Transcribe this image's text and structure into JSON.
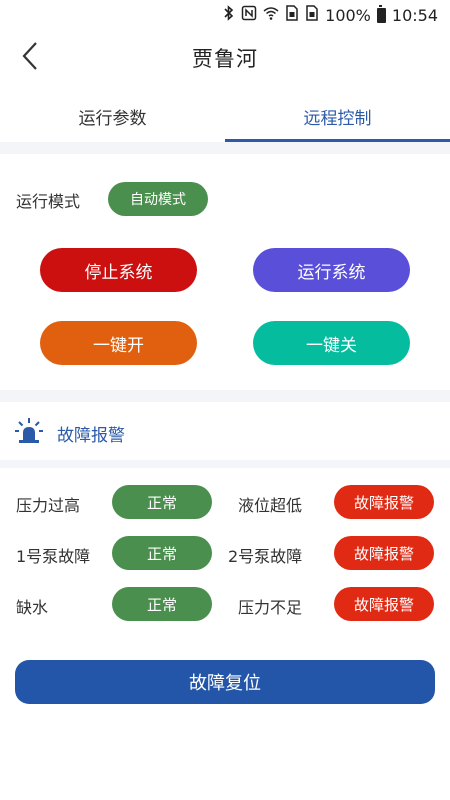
{
  "status_bar": {
    "icons": [
      "bluetooth-icon",
      "nfc-icon",
      "wifi-icon",
      "sim1-icon",
      "sim2-icon",
      "battery-icon"
    ],
    "battery": "100%",
    "time": "10:54"
  },
  "header": {
    "title": "贾鲁河",
    "back_icon": "chevron-left-icon"
  },
  "tabs": [
    {
      "label": "运行参数",
      "active": false
    },
    {
      "label": "远程控制",
      "active": true
    }
  ],
  "control": {
    "mode_label": "运行模式",
    "mode_value": "自动模式",
    "buttons": {
      "stop": "停止系统",
      "run": "运行系统",
      "one_key_on": "一键开",
      "one_key_off": "一键关"
    }
  },
  "alarm": {
    "title": "故障报警",
    "icon": "siren-icon",
    "items": [
      {
        "label": "压力过高",
        "status": "正常"
      },
      {
        "label": "液位超低",
        "status": "故障报警"
      },
      {
        "label": "1号泵故障",
        "status": "正常"
      },
      {
        "label": "2号泵故障",
        "status": "故障报警"
      },
      {
        "label": "缺水",
        "status": "正常"
      },
      {
        "label": "压力不足",
        "status": "故障报警"
      }
    ],
    "reset_label": "故障复位"
  },
  "colors": {
    "accent": "#2a5aa8",
    "ok": "#4a8f4d",
    "alarm": "#e02a14",
    "stop": "#cc1010",
    "run": "#5a4fd8",
    "on": "#e0600f",
    "off": "#06bc9f",
    "reset": "#2356a8"
  }
}
